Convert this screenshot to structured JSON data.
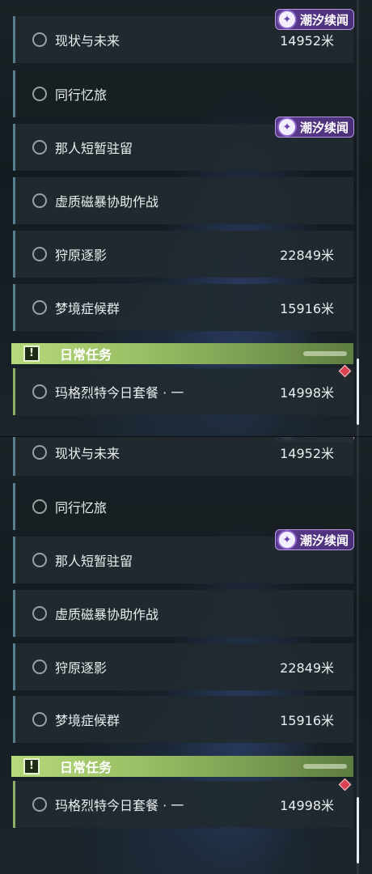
{
  "badge_label": "潮汐续闻",
  "daily_header": {
    "title": "日常任务",
    "icon": "!"
  },
  "quests": [
    {
      "title": "现状与未来",
      "distance": "14952米"
    },
    {
      "title": "同行忆旅",
      "distance": ""
    },
    {
      "title": "那人短暂驻留",
      "distance": ""
    },
    {
      "title": "虚质磁暴协助作战",
      "distance": ""
    },
    {
      "title": "狩原逐影",
      "distance": "22849米"
    },
    {
      "title": "梦境症候群",
      "distance": "15916米"
    }
  ],
  "daily_quest": {
    "title": "玛格烈特今日套餐 · 一",
    "distance": "14998米"
  },
  "colors": {
    "accent_daily": "#b5d97a",
    "badge_purple": "#5a3a8c",
    "quest_marker_red": "#d94050"
  },
  "icons": {
    "status": "circle-outline-icon",
    "badge": "tide-emblem-icon",
    "daily": "exclamation-icon",
    "marker": "diamond-marker-icon"
  }
}
